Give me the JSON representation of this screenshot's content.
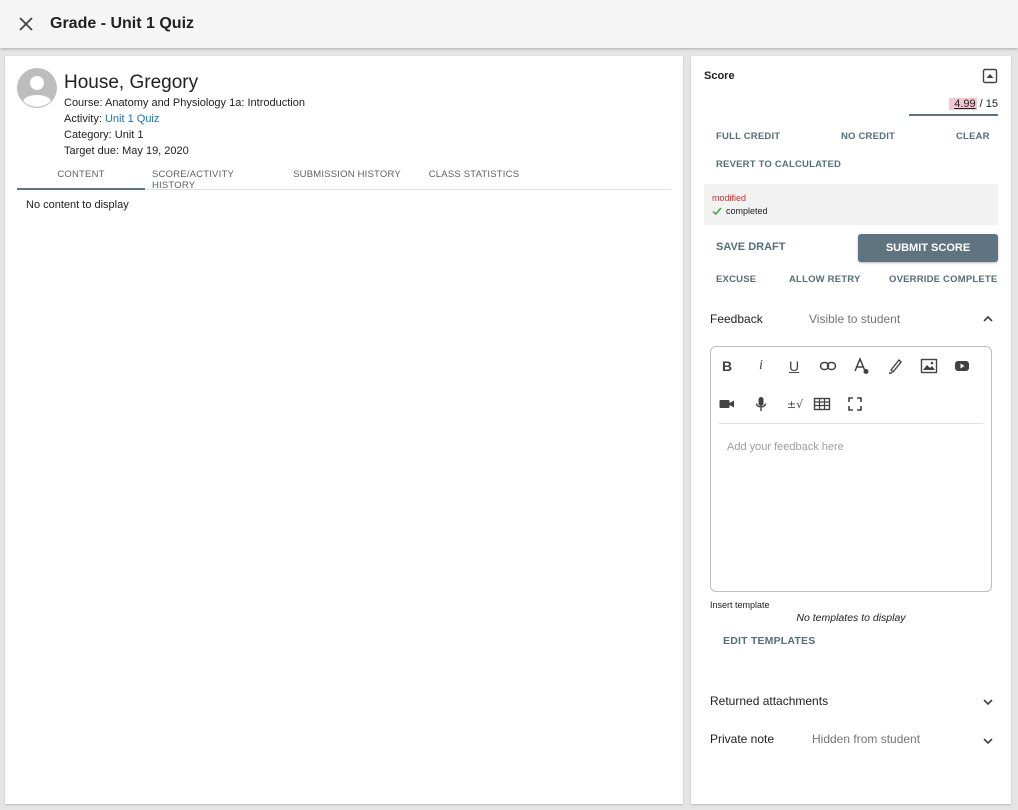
{
  "header": {
    "title": "Grade - Unit 1 Quiz",
    "close_icon": "close-icon"
  },
  "student": {
    "name": "House, Gregory",
    "course_label": "Course:",
    "course": "Anatomy and Physiology 1a: Introduction",
    "activity_label": "Activity:",
    "activity": "Unit 1 Quiz",
    "category_label": "Category:",
    "category": "Unit 1",
    "due_label": "Target due:",
    "due": "May 19, 2020"
  },
  "tabs": [
    {
      "label": "CONTENT",
      "active": true
    },
    {
      "label": "SCORE/ACTIVITY HISTORY",
      "active": false
    },
    {
      "label": "SUBMISSION HISTORY",
      "active": false
    },
    {
      "label": "CLASS STATISTICS",
      "active": false
    }
  ],
  "content": {
    "empty_text": "No content to display"
  },
  "score": {
    "label": "Score",
    "value": "4.99",
    "max": "/ 15",
    "full_credit": "FULL CREDIT",
    "no_credit": "NO CREDIT",
    "clear": "CLEAR",
    "revert": "REVERT TO CALCULATED",
    "status_modified": "modified",
    "status_completed": "completed",
    "save_draft": "SAVE DRAFT",
    "submit": "SUBMIT SCORE",
    "excuse": "EXCUSE",
    "allow_retry": "ALLOW RETRY",
    "override_complete": "OVERRIDE COMPLETE"
  },
  "feedback": {
    "label": "Feedback",
    "visibility": "Visible to student",
    "placeholder": "Add your feedback here",
    "toolbar": [
      "bold-icon",
      "italic-icon",
      "underline-icon",
      "link-icon",
      "text-color-icon",
      "highlight-icon",
      "image-icon",
      "youtube-icon",
      "video-icon",
      "microphone-icon",
      "math-icon",
      "table-icon",
      "fullscreen-icon"
    ],
    "math_glyph": "±√",
    "insert_template": "Insert template",
    "no_templates": "No templates to display",
    "edit_templates": "EDIT TEMPLATES"
  },
  "returned_attachments": {
    "label": "Returned attachments"
  },
  "private_note": {
    "label": "Private note",
    "visibility": "Hidden from student"
  },
  "colors": {
    "accent": "#5f7480",
    "link": "#1e6fb8",
    "modified": "#d32f2f",
    "score_highlight": "#f4c6d3"
  }
}
